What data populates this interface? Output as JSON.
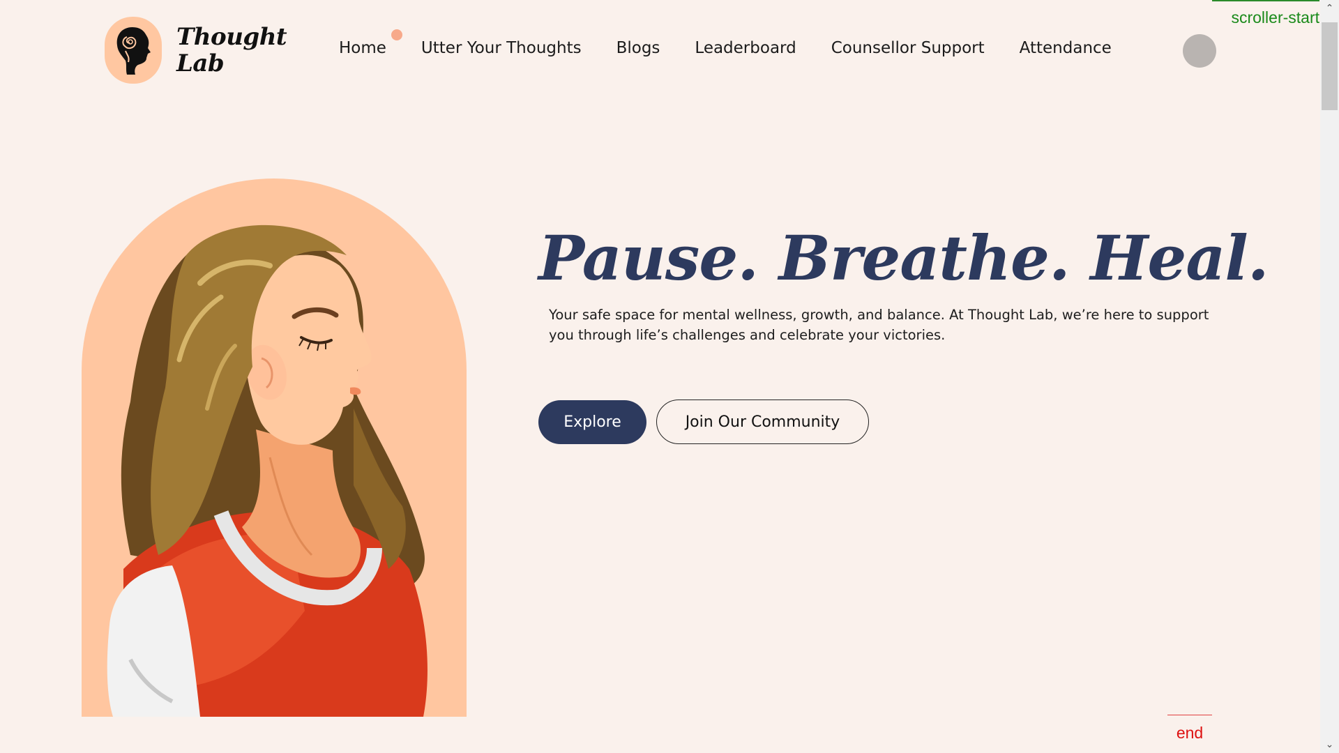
{
  "brand": {
    "name_line1": "Thought",
    "name_line2": "Lab",
    "logo_icon": "brain-head-icon"
  },
  "nav": {
    "items": [
      {
        "label": "Home"
      },
      {
        "label": "Utter Your Thoughts"
      },
      {
        "label": "Blogs"
      },
      {
        "label": "Leaderboard"
      },
      {
        "label": "Counsellor Support"
      },
      {
        "label": "Attendance"
      }
    ],
    "active": "Home"
  },
  "hero": {
    "title": "Pause. Breathe. Heal.",
    "description": "Your safe space for mental wellness, growth, and balance. At Thought Lab, we’re here to support you through life’s challenges and celebrate your victories.",
    "primary_button": "Explore",
    "secondary_button": "Join Our Community"
  },
  "markers": {
    "start": "scroller-start",
    "end": "end"
  },
  "colors": {
    "background": "#faf1ec",
    "accent_peach": "#ffc6a0",
    "navy": "#2d3a5e",
    "dot": "#f7a98a"
  }
}
